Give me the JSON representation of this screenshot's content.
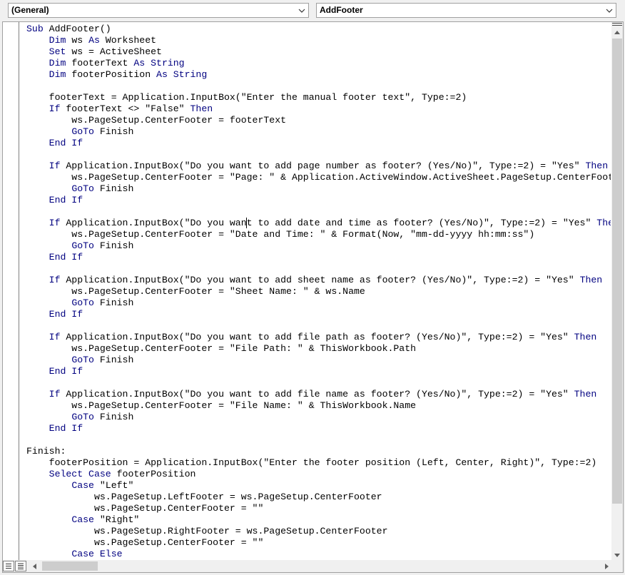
{
  "object_combo": {
    "value": "(General)"
  },
  "procedure_combo": {
    "value": "AddFooter"
  },
  "code": {
    "lines": [
      [
        {
          "t": "Sub ",
          "k": true
        },
        {
          "t": "AddFooter()"
        }
      ],
      [
        {
          "t": "    "
        },
        {
          "t": "Dim",
          "k": true
        },
        {
          "t": " ws "
        },
        {
          "t": "As",
          "k": true
        },
        {
          "t": " Worksheet"
        }
      ],
      [
        {
          "t": "    "
        },
        {
          "t": "Set",
          "k": true
        },
        {
          "t": " ws = ActiveSheet"
        }
      ],
      [
        {
          "t": "    "
        },
        {
          "t": "Dim",
          "k": true
        },
        {
          "t": " footerText "
        },
        {
          "t": "As String",
          "k": true
        }
      ],
      [
        {
          "t": "    "
        },
        {
          "t": "Dim",
          "k": true
        },
        {
          "t": " footerPosition "
        },
        {
          "t": "As String",
          "k": true
        }
      ],
      [],
      [
        {
          "t": "    footerText = Application.InputBox(\"Enter the manual footer text\", Type:=2)"
        }
      ],
      [
        {
          "t": "    "
        },
        {
          "t": "If",
          "k": true
        },
        {
          "t": " footerText <> \"False\" "
        },
        {
          "t": "Then",
          "k": true
        }
      ],
      [
        {
          "t": "        ws.PageSetup.CenterFooter = footerText"
        }
      ],
      [
        {
          "t": "        "
        },
        {
          "t": "GoTo",
          "k": true
        },
        {
          "t": " Finish"
        }
      ],
      [
        {
          "t": "    "
        },
        {
          "t": "End If",
          "k": true
        }
      ],
      [],
      [
        {
          "t": "    "
        },
        {
          "t": "If",
          "k": true
        },
        {
          "t": " Application.InputBox(\"Do you want to add page number as footer? (Yes/No)\", Type:=2) = \"Yes\" "
        },
        {
          "t": "Then",
          "k": true
        }
      ],
      [
        {
          "t": "        ws.PageSetup.CenterFooter = \"Page: \" & Application.ActiveWindow.ActiveSheet.PageSetup.CenterFooter"
        }
      ],
      [
        {
          "t": "        "
        },
        {
          "t": "GoTo",
          "k": true
        },
        {
          "t": " Finish"
        }
      ],
      [
        {
          "t": "    "
        },
        {
          "t": "End If",
          "k": true
        }
      ],
      [],
      [
        {
          "t": "    "
        },
        {
          "t": "If",
          "k": true
        },
        {
          "t": " Application.InputBox(\"Do you wan"
        },
        {
          "caret": true
        },
        {
          "t": "t to add date and time as footer? (Yes/No)\", Type:=2) = \"Yes\" "
        },
        {
          "t": "Then",
          "k": true
        }
      ],
      [
        {
          "t": "        ws.PageSetup.CenterFooter = \"Date and Time: \" & Format(Now, \"mm-dd-yyyy hh:mm:ss\")"
        }
      ],
      [
        {
          "t": "        "
        },
        {
          "t": "GoTo",
          "k": true
        },
        {
          "t": " Finish"
        }
      ],
      [
        {
          "t": "    "
        },
        {
          "t": "End If",
          "k": true
        }
      ],
      [],
      [
        {
          "t": "    "
        },
        {
          "t": "If",
          "k": true
        },
        {
          "t": " Application.InputBox(\"Do you want to add sheet name as footer? (Yes/No)\", Type:=2) = \"Yes\" "
        },
        {
          "t": "Then",
          "k": true
        }
      ],
      [
        {
          "t": "        ws.PageSetup.CenterFooter = \"Sheet Name: \" & ws.Name"
        }
      ],
      [
        {
          "t": "        "
        },
        {
          "t": "GoTo",
          "k": true
        },
        {
          "t": " Finish"
        }
      ],
      [
        {
          "t": "    "
        },
        {
          "t": "End If",
          "k": true
        }
      ],
      [],
      [
        {
          "t": "    "
        },
        {
          "t": "If",
          "k": true
        },
        {
          "t": " Application.InputBox(\"Do you want to add file path as footer? (Yes/No)\", Type:=2) = \"Yes\" "
        },
        {
          "t": "Then",
          "k": true
        }
      ],
      [
        {
          "t": "        ws.PageSetup.CenterFooter = \"File Path: \" & ThisWorkbook.Path"
        }
      ],
      [
        {
          "t": "        "
        },
        {
          "t": "GoTo",
          "k": true
        },
        {
          "t": " Finish"
        }
      ],
      [
        {
          "t": "    "
        },
        {
          "t": "End If",
          "k": true
        }
      ],
      [],
      [
        {
          "t": "    "
        },
        {
          "t": "If",
          "k": true
        },
        {
          "t": " Application.InputBox(\"Do you want to add file name as footer? (Yes/No)\", Type:=2) = \"Yes\" "
        },
        {
          "t": "Then",
          "k": true
        }
      ],
      [
        {
          "t": "        ws.PageSetup.CenterFooter = \"File Name: \" & ThisWorkbook.Name"
        }
      ],
      [
        {
          "t": "        "
        },
        {
          "t": "GoTo",
          "k": true
        },
        {
          "t": " Finish"
        }
      ],
      [
        {
          "t": "    "
        },
        {
          "t": "End If",
          "k": true
        }
      ],
      [],
      [
        {
          "t": "Finish:"
        }
      ],
      [
        {
          "t": "    footerPosition = Application.InputBox(\"Enter the footer position (Left, Center, Right)\", Type:=2)"
        }
      ],
      [
        {
          "t": "    "
        },
        {
          "t": "Select Case",
          "k": true
        },
        {
          "t": " footerPosition"
        }
      ],
      [
        {
          "t": "        "
        },
        {
          "t": "Case",
          "k": true
        },
        {
          "t": " \"Left\""
        }
      ],
      [
        {
          "t": "            ws.PageSetup.LeftFooter = ws.PageSetup.CenterFooter"
        }
      ],
      [
        {
          "t": "            ws.PageSetup.CenterFooter = \"\""
        }
      ],
      [
        {
          "t": "        "
        },
        {
          "t": "Case",
          "k": true
        },
        {
          "t": " \"Right\""
        }
      ],
      [
        {
          "t": "            ws.PageSetup.RightFooter = ws.PageSetup.CenterFooter"
        }
      ],
      [
        {
          "t": "            ws.PageSetup.CenterFooter = \"\""
        }
      ],
      [
        {
          "t": "        "
        },
        {
          "t": "Case Else",
          "k": true
        }
      ]
    ]
  },
  "colors": {
    "keyword": "#000080",
    "text": "#000000",
    "background": "#ffffff",
    "chrome": "#f0f0f0"
  },
  "icons": [
    "chevron-down-icon",
    "scroll-up-icon",
    "scroll-down-icon",
    "scroll-left-icon",
    "scroll-right-icon",
    "procedure-view-icon",
    "full-module-view-icon",
    "split-bar-icon"
  ]
}
